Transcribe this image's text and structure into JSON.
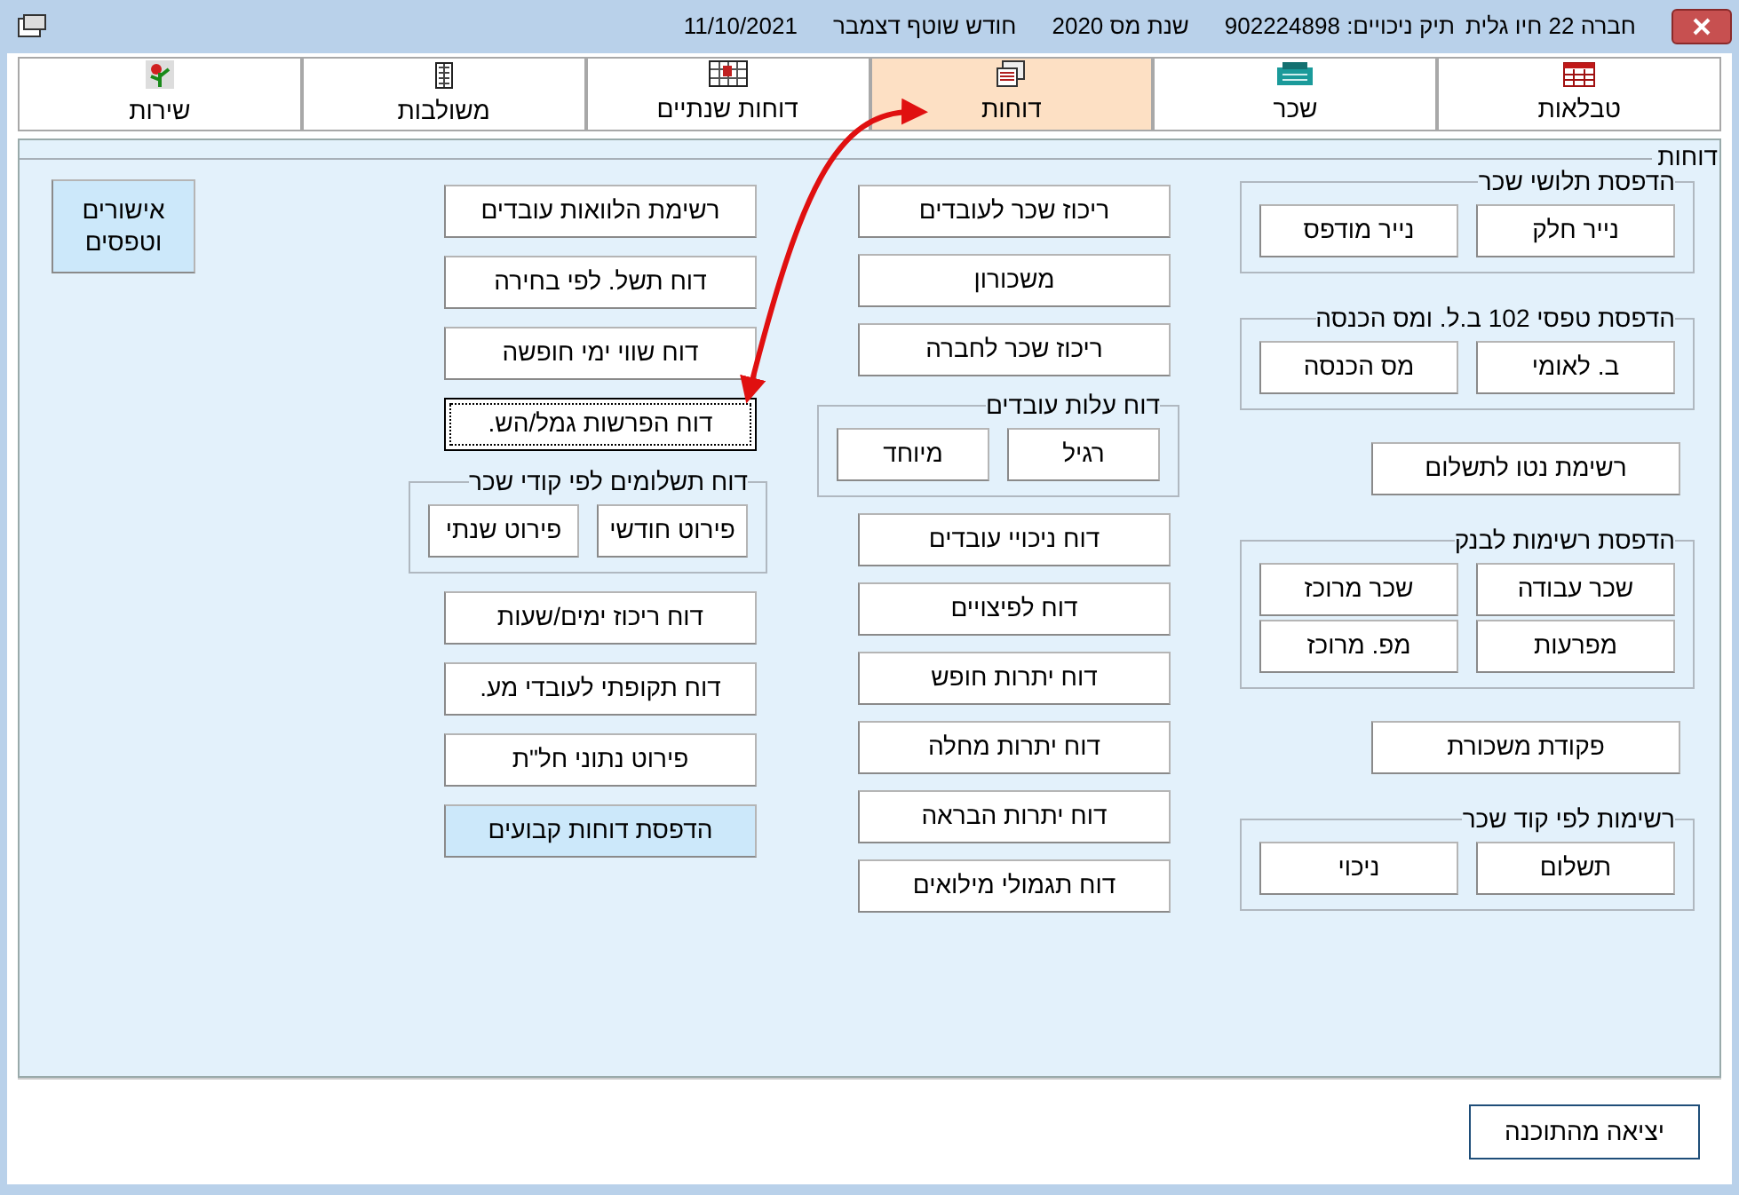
{
  "window": {
    "company": "חברה 22 חיו גלית",
    "file": "תיק ניכויים: 902224898",
    "tax_year": "שנת מס 2020",
    "month": "חודש שוטף דצמבר",
    "date": "11/10/2021"
  },
  "tabs": [
    {
      "label": "טבלאות",
      "kind": "table",
      "selected": false
    },
    {
      "label": "שכר",
      "kind": "register",
      "selected": false
    },
    {
      "label": "דוחות",
      "kind": "report",
      "selected": true
    },
    {
      "label": "דוחות שנתיים",
      "kind": "calendar",
      "selected": false
    },
    {
      "label": "משולבות",
      "kind": "building",
      "selected": false
    },
    {
      "label": "שירות",
      "kind": "plant",
      "selected": false
    }
  ],
  "panel": {
    "title": "דוחות",
    "columns": [
      {
        "items": [
          {
            "kind": "group",
            "title": "הדפסת תלושי שכר",
            "buttons": [
              {
                "label": "נייר חלק",
                "highlighted": false,
                "focused": false
              },
              {
                "label": "נייר מודפס",
                "highlighted": false,
                "focused": false
              }
            ]
          },
          {
            "kind": "group",
            "title": "הדפסת טפסי 102 ב.ל. ומס הכנסה",
            "buttons": [
              {
                "label": "ב. לאומי",
                "highlighted": false,
                "focused": false
              },
              {
                "label": "מס הכנסה",
                "highlighted": false,
                "focused": false
              }
            ]
          },
          {
            "kind": "button",
            "label": "רשימת נטו לתשלום",
            "highlighted": false,
            "focused": false
          },
          {
            "kind": "group",
            "title": "הדפסת רשימות לבנק",
            "buttons": [
              {
                "label": "שכר עבודה",
                "highlighted": false,
                "focused": false
              },
              {
                "label": "שכר מרוכז",
                "highlighted": false,
                "focused": false
              },
              {
                "label": "מפרעות",
                "highlighted": false,
                "focused": false
              },
              {
                "label": "מפ. מרוכז",
                "highlighted": false,
                "focused": false
              }
            ]
          },
          {
            "kind": "button",
            "label": "פקודת משכורת",
            "highlighted": false,
            "focused": false
          },
          {
            "kind": "group",
            "title": "רשימות לפי קוד שכר",
            "buttons": [
              {
                "label": "תשלום",
                "highlighted": false,
                "focused": false
              },
              {
                "label": "ניכוי",
                "highlighted": false,
                "focused": false
              }
            ]
          }
        ]
      },
      {
        "items": [
          {
            "kind": "button",
            "label": "ריכוז שכר לעובדים",
            "highlighted": false,
            "focused": false
          },
          {
            "kind": "button",
            "label": "משכורון",
            "highlighted": false,
            "focused": false
          },
          {
            "kind": "button",
            "label": "ריכוז שכר לחברה",
            "highlighted": false,
            "focused": false
          },
          {
            "kind": "group",
            "title": "דוח עלות עובדים",
            "buttons": [
              {
                "label": "רגיל",
                "highlighted": false,
                "focused": false
              },
              {
                "label": "מיוחד",
                "highlighted": false,
                "focused": false
              }
            ]
          },
          {
            "kind": "button",
            "label": "דוח ניכויי עובדים",
            "highlighted": false,
            "focused": false
          },
          {
            "kind": "button",
            "label": "דוח לפיצויים",
            "highlighted": false,
            "focused": false
          },
          {
            "kind": "button",
            "label": "דוח יתרות חופש",
            "highlighted": false,
            "focused": false
          },
          {
            "kind": "button",
            "label": "דוח יתרות מחלה",
            "highlighted": false,
            "focused": false
          },
          {
            "kind": "button",
            "label": "דוח יתרות הבראה",
            "highlighted": false,
            "focused": false
          },
          {
            "kind": "button",
            "label": "דוח תגמולי מילואים",
            "highlighted": false,
            "focused": false
          }
        ]
      },
      {
        "items": [
          {
            "kind": "button",
            "label": "רשימת הלוואות עובדים",
            "highlighted": false,
            "focused": false
          },
          {
            "kind": "button",
            "label": "דוח תשל. לפי בחירה",
            "highlighted": false,
            "focused": false
          },
          {
            "kind": "button",
            "label": "דוח שווי ימי חופשה",
            "highlighted": false,
            "focused": false
          },
          {
            "kind": "button",
            "label": "דוח הפרשות גמל/הש.",
            "highlighted": false,
            "focused": true
          },
          {
            "kind": "group",
            "title": "דוח תשלומים לפי קודי שכר",
            "buttons": [
              {
                "label": "פירוט חודשי",
                "highlighted": false,
                "focused": false
              },
              {
                "label": "פירוט שנתי",
                "highlighted": false,
                "focused": false
              }
            ]
          },
          {
            "kind": "button",
            "label": "דוח ריכוז ימים/שעות",
            "highlighted": false,
            "focused": false
          },
          {
            "kind": "button",
            "label": "דוח תקופתי לעובדי מע.",
            "highlighted": false,
            "focused": false
          },
          {
            "kind": "button",
            "label": "פירוט נתוני חל\"ת",
            "highlighted": false,
            "focused": false
          },
          {
            "kind": "button",
            "label": "הדפסת דוחות קבועים",
            "highlighted": true,
            "focused": false
          }
        ]
      },
      {
        "items": [
          {
            "kind": "button",
            "label": "אישורים וטפסים",
            "highlighted": true,
            "focused": false
          }
        ]
      }
    ]
  },
  "exit_button": {
    "label": "יציאה מהתוכנה"
  }
}
